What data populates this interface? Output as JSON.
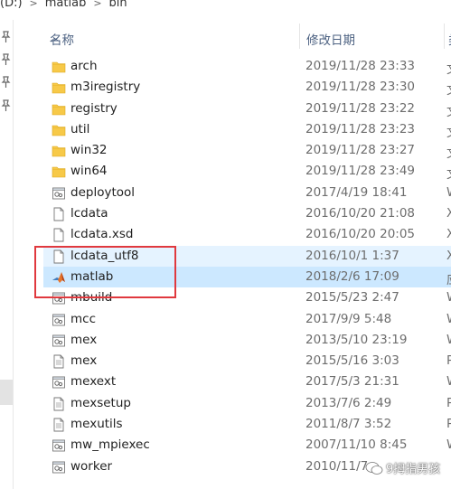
{
  "breadcrumb": {
    "drive": "(D:)",
    "items": [
      "matlab",
      "bin"
    ]
  },
  "columns": {
    "name": "名称",
    "date": "修改日期",
    "type": "类"
  },
  "files": [
    {
      "name": "arch",
      "date": "2019/11/28 23:33",
      "type": "文",
      "icon": "folder-icon"
    },
    {
      "name": "m3iregistry",
      "date": "2019/11/28 23:30",
      "type": "文",
      "icon": "folder-icon"
    },
    {
      "name": "registry",
      "date": "2019/11/28 23:22",
      "type": "文",
      "icon": "folder-icon"
    },
    {
      "name": "util",
      "date": "2019/11/28 23:23",
      "type": "文",
      "icon": "folder-icon"
    },
    {
      "name": "win32",
      "date": "2019/11/28 23:27",
      "type": "文",
      "icon": "folder-icon"
    },
    {
      "name": "win64",
      "date": "2019/11/28 23:49",
      "type": "文",
      "icon": "folder-icon"
    },
    {
      "name": "deploytool",
      "date": "2017/4/19 18:41",
      "type": "W",
      "icon": "batch-file-icon"
    },
    {
      "name": "lcdata",
      "date": "2016/10/20 21:08",
      "type": "X",
      "icon": "document-icon"
    },
    {
      "name": "lcdata.xsd",
      "date": "2016/10/20 20:05",
      "type": "X",
      "icon": "document-icon"
    },
    {
      "name": "lcdata_utf8",
      "date": "2016/10/1 1:37",
      "type": "X",
      "icon": "document-icon",
      "state": "hover"
    },
    {
      "name": "matlab",
      "date": "2018/2/6 17:09",
      "type": "应",
      "icon": "matlab-logo-icon",
      "state": "selected"
    },
    {
      "name": "mbuild",
      "date": "2015/5/23 2:47",
      "type": "W",
      "icon": "batch-file-icon"
    },
    {
      "name": "mcc",
      "date": "2017/9/9 5:48",
      "type": "W",
      "icon": "batch-file-icon"
    },
    {
      "name": "mex",
      "date": "2013/5/10 23:19",
      "type": "W",
      "icon": "batch-file-icon"
    },
    {
      "name": "mex",
      "date": "2015/5/16 3:03",
      "type": "P",
      "icon": "text-file-icon"
    },
    {
      "name": "mexext",
      "date": "2017/5/3 21:31",
      "type": "W",
      "icon": "batch-file-icon"
    },
    {
      "name": "mexsetup",
      "date": "2013/7/6 2:49",
      "type": "P",
      "icon": "text-file-icon"
    },
    {
      "name": "mexutils",
      "date": "2011/8/7 3:52",
      "type": "P",
      "icon": "text-file-icon"
    },
    {
      "name": "mw_mpiexec",
      "date": "2007/11/10 8:45",
      "type": "W",
      "icon": "batch-file-icon"
    },
    {
      "name": "worker",
      "date": "2010/11/7",
      "type": "",
      "icon": "batch-file-icon"
    }
  ],
  "watermark": {
    "text": "9拇指男孩"
  },
  "colors": {
    "hover": "#e5f3ff",
    "selected": "#cce8ff",
    "annotation": "#e0393e",
    "folder": "#f7c948",
    "header_text": "#4d6282"
  }
}
